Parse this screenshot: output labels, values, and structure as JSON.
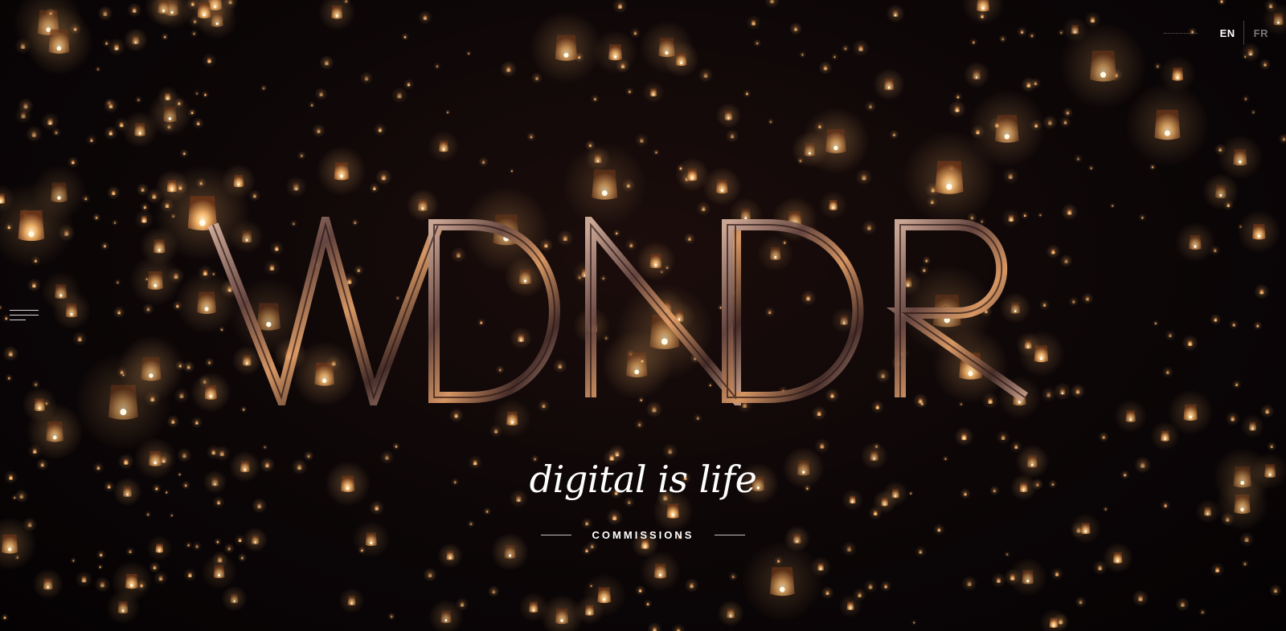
{
  "site": {
    "logo_text": "WDNDR",
    "tagline": "digital is life",
    "cta_label": "COMMISSIONS"
  },
  "language": {
    "options": [
      "EN",
      "FR"
    ],
    "active": "EN"
  },
  "menu": {
    "icon": "hamburger-menu-icon"
  },
  "colors": {
    "background": "#0a0506",
    "lantern_glow": "#f3b46a",
    "text": "#ffffff"
  }
}
